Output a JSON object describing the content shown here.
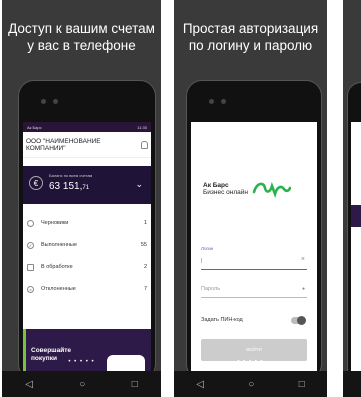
{
  "panels": [
    {
      "headline": [
        "Доступ к вашим счетам",
        "у вас в телефоне"
      ],
      "status_left": "Ак Барс",
      "status_right": "11:30",
      "company": "ООО \"НАИМЕНОВАНИЕ КОМПАНИИ\"",
      "balance_label": "Баланс по всем счетам",
      "balance_amount": "63 151,",
      "balance_cents": "71",
      "rows": [
        {
          "label": "Черновики",
          "count": "1"
        },
        {
          "label": "Выполненные",
          "count": "55"
        },
        {
          "label": "В обработке",
          "count": "2"
        },
        {
          "label": "Отклоненные",
          "count": "7"
        }
      ],
      "promo_line1": "Совершайте",
      "promo_line2": "покупки"
    },
    {
      "headline": [
        "Простая авторизация",
        "по логину и паролю"
      ],
      "logo_line1": "Ак Барс",
      "logo_line2": "Бизнес онлайн",
      "login_label": "Логин",
      "password_placeholder": "Пароль",
      "pin_label": "Задать ПИН-код",
      "login_button": "ВОЙТИ"
    }
  ],
  "nav": {
    "back": "◁",
    "home": "○",
    "recent": "□"
  },
  "pager_dots": "• • • • •",
  "colors": {
    "bg": "#3a3a3a",
    "accent": "#1f1338",
    "brand_green": "#2bb24c"
  }
}
